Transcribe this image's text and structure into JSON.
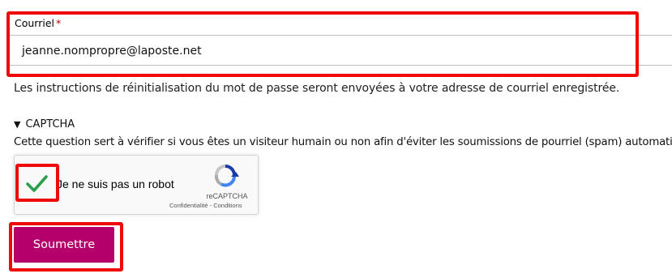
{
  "form": {
    "email_label": "Courriel",
    "required_mark": "*",
    "email_value": "jeanne.nompropre@laposte.net",
    "help_text": "Les instructions de réinitialisation du mot de passe seront envoyées à votre adresse de courriel enregistrée.",
    "submit_label": "Soumettre"
  },
  "captcha": {
    "summary": "CAPTCHA",
    "expanded": true,
    "description": "Cette question sert à vérifier si vous êtes un visiteur humain ou non afin d'éviter les soumissions de pourriel (spam) automatisées.",
    "checkbox_label": "Je ne suis pas un robot",
    "checked": true,
    "brand": "reCAPTCHA",
    "links": "Confidentialité - Conditions"
  },
  "icons": {
    "checkmark": "checkmark-icon",
    "recaptcha_logo": "recaptcha-logo-icon",
    "disclosure": "triangle-down-icon"
  },
  "colors": {
    "submit_bg": "#b5006b",
    "highlight": "#ee0a0a",
    "checkmark": "#2e9e4a",
    "required": "#c00000"
  }
}
